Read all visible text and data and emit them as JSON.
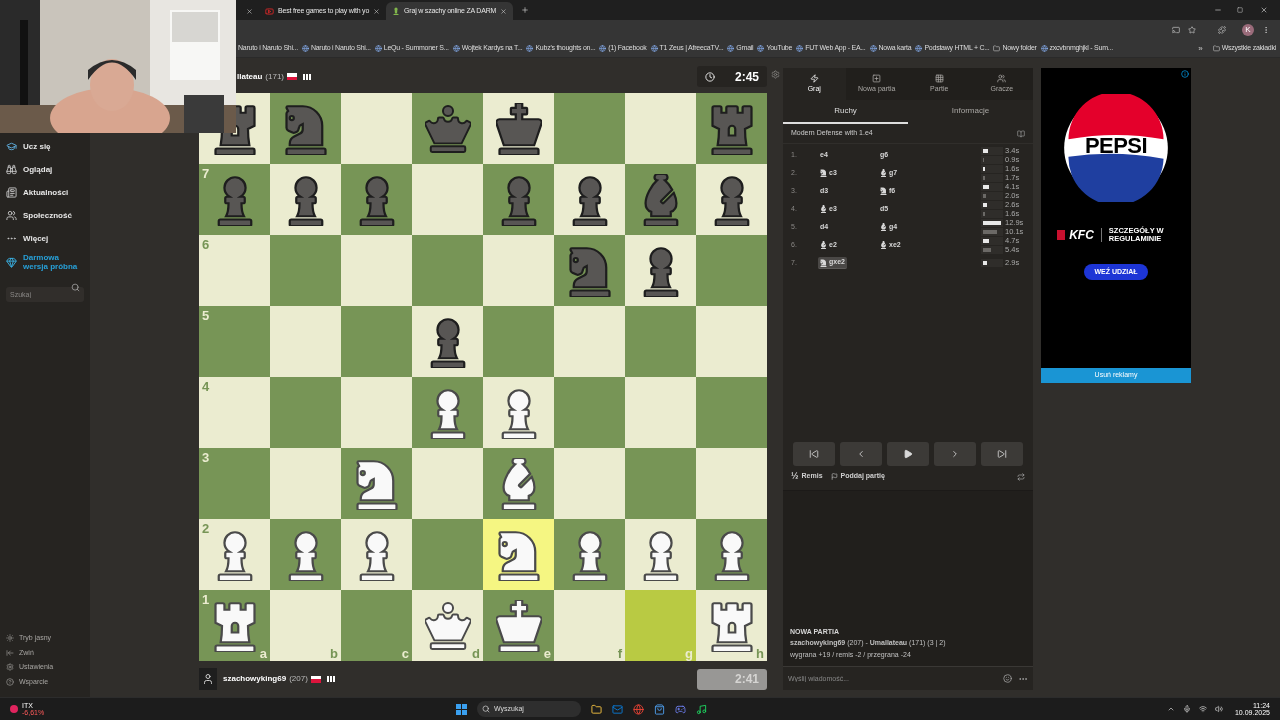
{
  "browser": {
    "tabs": [
      {
        "kind": "hidden",
        "selected": false
      },
      {
        "title": "Best free games to play with yo",
        "kind": "video",
        "selected": false
      },
      {
        "title": "Graj w szachy online ZA DARM",
        "kind": "chess",
        "selected": true
      }
    ],
    "bookmarks": [
      "Naruto i Naruto Shi...",
      "Naruto i Naruto Shi...",
      "LeQu - Summoner S...",
      "Wojtek Kardys na T...",
      "Kubz's thoughts on...",
      "(1) Facebook",
      "T1 Zeus | AfreecaTV...",
      "Gmail",
      "YouTube",
      "FUT Web App - EA...",
      "Nowa karta",
      "Podstawy HTML + C...",
      "Nowy folder",
      "zxcvbnmghjkl - Sum..."
    ],
    "more": "»",
    "all_bookmarks": "Wszystkie zakładki",
    "profile": "K"
  },
  "sidebar": {
    "items": [
      {
        "label": "Ucz się",
        "kind": "nav"
      },
      {
        "label": "Oglądaj",
        "kind": "nav"
      },
      {
        "label": "Aktualności",
        "kind": "nav"
      },
      {
        "label": "Społeczność",
        "kind": "nav"
      },
      {
        "label": "Więcej",
        "kind": "nav"
      },
      {
        "label": "Darmowa wersja próbna",
        "kind": "promo"
      }
    ],
    "search": {
      "placeholder": "Szukaj"
    },
    "footer": [
      "Tryb jasny",
      "Zwiń",
      "Ustawienia",
      "Wsparcie"
    ]
  },
  "top_player": {
    "name": "llateau",
    "rating": "(171)",
    "clock": {
      "time": "2:45",
      "running": true
    }
  },
  "board": {
    "rows": [
      [
        {
          "kind": "rook",
          "black": true,
          "highlighted": false
        },
        {
          "kind": "knight",
          "black": true,
          "highlighted": false
        },
        {
          "kind": "empty",
          "highlighted": false
        },
        {
          "kind": "queen",
          "black": true,
          "highlighted": false
        },
        {
          "kind": "king",
          "black": true,
          "highlighted": false
        },
        {
          "kind": "empty",
          "highlighted": false
        },
        {
          "kind": "empty",
          "highlighted": false
        },
        {
          "kind": "rook",
          "black": true,
          "highlighted": false
        }
      ],
      [
        {
          "kind": "pawn",
          "black": true,
          "highlighted": false
        },
        {
          "kind": "pawn",
          "black": true,
          "highlighted": false
        },
        {
          "kind": "pawn",
          "black": true,
          "highlighted": false
        },
        {
          "kind": "empty",
          "highlighted": false
        },
        {
          "kind": "pawn",
          "black": true,
          "highlighted": false
        },
        {
          "kind": "pawn",
          "black": true,
          "highlighted": false
        },
        {
          "kind": "bishop",
          "black": true,
          "highlighted": false
        },
        {
          "kind": "pawn",
          "black": true,
          "highlighted": false
        }
      ],
      [
        {
          "kind": "empty",
          "highlighted": false
        },
        {
          "kind": "empty",
          "highlighted": false
        },
        {
          "kind": "empty",
          "highlighted": false
        },
        {
          "kind": "empty",
          "highlighted": false
        },
        {
          "kind": "empty",
          "highlighted": false
        },
        {
          "kind": "knight",
          "black": true,
          "highlighted": false
        },
        {
          "kind": "pawn",
          "black": true,
          "highlighted": false
        },
        {
          "kind": "empty",
          "highlighted": false
        }
      ],
      [
        {
          "kind": "empty",
          "highlighted": false
        },
        {
          "kind": "empty",
          "highlighted": false
        },
        {
          "kind": "empty",
          "highlighted": false
        },
        {
          "kind": "pawn",
          "black": true,
          "highlighted": false
        },
        {
          "kind": "empty",
          "highlighted": false
        },
        {
          "kind": "empty",
          "highlighted": false
        },
        {
          "kind": "empty",
          "highlighted": false
        },
        {
          "kind": "empty",
          "highlighted": false
        }
      ],
      [
        {
          "kind": "empty",
          "highlighted": false
        },
        {
          "kind": "empty",
          "highlighted": false
        },
        {
          "kind": "empty",
          "highlighted": false
        },
        {
          "kind": "pawn",
          "black": false,
          "highlighted": false
        },
        {
          "kind": "pawn",
          "black": false,
          "highlighted": false
        },
        {
          "kind": "empty",
          "highlighted": false
        },
        {
          "kind": "empty",
          "highlighted": false
        },
        {
          "kind": "empty",
          "highlighted": false
        }
      ],
      [
        {
          "kind": "empty",
          "highlighted": false
        },
        {
          "kind": "empty",
          "highlighted": false
        },
        {
          "kind": "knight",
          "black": false,
          "highlighted": false
        },
        {
          "kind": "empty",
          "highlighted": false
        },
        {
          "kind": "bishop",
          "black": false,
          "highlighted": false
        },
        {
          "kind": "empty",
          "highlighted": false
        },
        {
          "kind": "empty",
          "highlighted": false
        },
        {
          "kind": "empty",
          "highlighted": false
        }
      ],
      [
        {
          "kind": "pawn",
          "black": false,
          "highlighted": false
        },
        {
          "kind": "pawn",
          "black": false,
          "highlighted": false
        },
        {
          "kind": "pawn",
          "black": false,
          "highlighted": false
        },
        {
          "kind": "empty",
          "highlighted": false
        },
        {
          "kind": "knight",
          "black": false,
          "highlighted": true
        },
        {
          "kind": "pawn",
          "black": false,
          "highlighted": false
        },
        {
          "kind": "pawn",
          "black": false,
          "highlighted": false
        },
        {
          "kind": "pawn",
          "black": false,
          "highlighted": false
        }
      ],
      [
        {
          "kind": "rook",
          "black": false,
          "highlighted": false
        },
        {
          "kind": "empty",
          "highlighted": false
        },
        {
          "kind": "empty",
          "highlighted": false
        },
        {
          "kind": "queen",
          "black": false,
          "highlighted": false
        },
        {
          "kind": "king",
          "black": false,
          "highlighted": false
        },
        {
          "kind": "empty",
          "highlighted": false
        },
        {
          "kind": "empty",
          "highlighted": true
        },
        {
          "kind": "rook",
          "black": false,
          "highlighted": false
        }
      ]
    ],
    "rank_labels": [
      "7",
      "6",
      "5",
      "4",
      "3",
      "2",
      "1"
    ],
    "file_labels": [
      "a",
      "b",
      "c",
      "d",
      "e",
      "f",
      "g",
      "h"
    ]
  },
  "bottom_player": {
    "name": "szachowyking69",
    "rating": "(207)",
    "clock": {
      "time": "2:41",
      "running": false
    }
  },
  "panel": {
    "tabs": [
      {
        "label": "Graj",
        "selected": true
      },
      {
        "label": "Nowa partia",
        "selected": false
      },
      {
        "label": "Partie",
        "selected": false
      },
      {
        "label": "Gracze",
        "selected": false
      }
    ],
    "subtabs": [
      {
        "label": "Ruchy",
        "selected": true
      },
      {
        "label": "Informacje",
        "selected": false
      }
    ],
    "opening": "Modern Defense with 1.e4",
    "moves": [
      {
        "number": "1.",
        "white": {
          "san": "e4",
          "kind": "pawn",
          "selected": false
        },
        "black": {
          "san": "g6",
          "kind": "pawn",
          "selected": false
        },
        "white_time": {
          "text": "3.4s",
          "level": 0.26
        },
        "black_time": {
          "text": "0.9s",
          "level": 0.07
        }
      },
      {
        "number": "2.",
        "white": {
          "san": "c3",
          "kind": "knight",
          "selected": false
        },
        "black": {
          "san": "g7",
          "kind": "bishop",
          "selected": false
        },
        "white_time": {
          "text": "1.6s",
          "level": 0.12
        },
        "black_time": {
          "text": "1.7s",
          "level": 0.13
        }
      },
      {
        "number": "3.",
        "white": {
          "san": "d3",
          "kind": "pawn",
          "selected": false
        },
        "black": {
          "san": "f6",
          "kind": "knight",
          "selected": false
        },
        "white_time": {
          "text": "4.1s",
          "level": 0.32
        },
        "black_time": {
          "text": "2.0s",
          "level": 0.16
        }
      },
      {
        "number": "4.",
        "white": {
          "san": "e3",
          "kind": "bishop",
          "selected": false
        },
        "black": {
          "san": "d5",
          "kind": "pawn",
          "selected": false
        },
        "white_time": {
          "text": "2.6s",
          "level": 0.2
        },
        "black_time": {
          "text": "1.6s",
          "level": 0.12
        }
      },
      {
        "number": "5.",
        "white": {
          "san": "d4",
          "kind": "pawn",
          "selected": false
        },
        "black": {
          "san": "g4",
          "kind": "bishop",
          "selected": false
        },
        "white_time": {
          "text": "12.9s",
          "level": 1.0
        },
        "black_time": {
          "text": "10.1s",
          "level": 0.78
        }
      },
      {
        "number": "6.",
        "white": {
          "san": "e2",
          "kind": "bishop",
          "selected": false
        },
        "black": {
          "san": "xe2",
          "kind": "bishop",
          "selected": false
        },
        "white_time": {
          "text": "4.7s",
          "level": 0.36
        },
        "black_time": {
          "text": "5.4s",
          "level": 0.42
        }
      },
      {
        "number": "7.",
        "white": {
          "san": "gxe2",
          "kind": "knight",
          "selected": true
        },
        "white_time": {
          "text": "2.9s",
          "level": 0.22
        }
      }
    ],
    "draw": {
      "symbol": "½",
      "label": "Remis"
    },
    "resign": "Poddaj partię",
    "chat": {
      "title": "NOWA PARTIA",
      "players": "**szachowyking69** (207) - **Umallateau** (171) (3 | 2)",
      "result": "wygrana +19 / remis -2 / przegrana -24",
      "placeholder": "Wyślij wiadomość..."
    }
  },
  "ad": {
    "brand": "PEPSI",
    "sponsor": "KFC",
    "fine_print": "SZCZEGÓŁY W REGULAMINIE",
    "cta": "WEŹ UDZIAŁ",
    "remove": "Usuń reklamy"
  },
  "taskbar": {
    "stock": {
      "symbol": "ITX",
      "change": "-6,61%"
    },
    "search": "Wyszukaj",
    "time": "11:24",
    "date": "10.09.2025"
  }
}
